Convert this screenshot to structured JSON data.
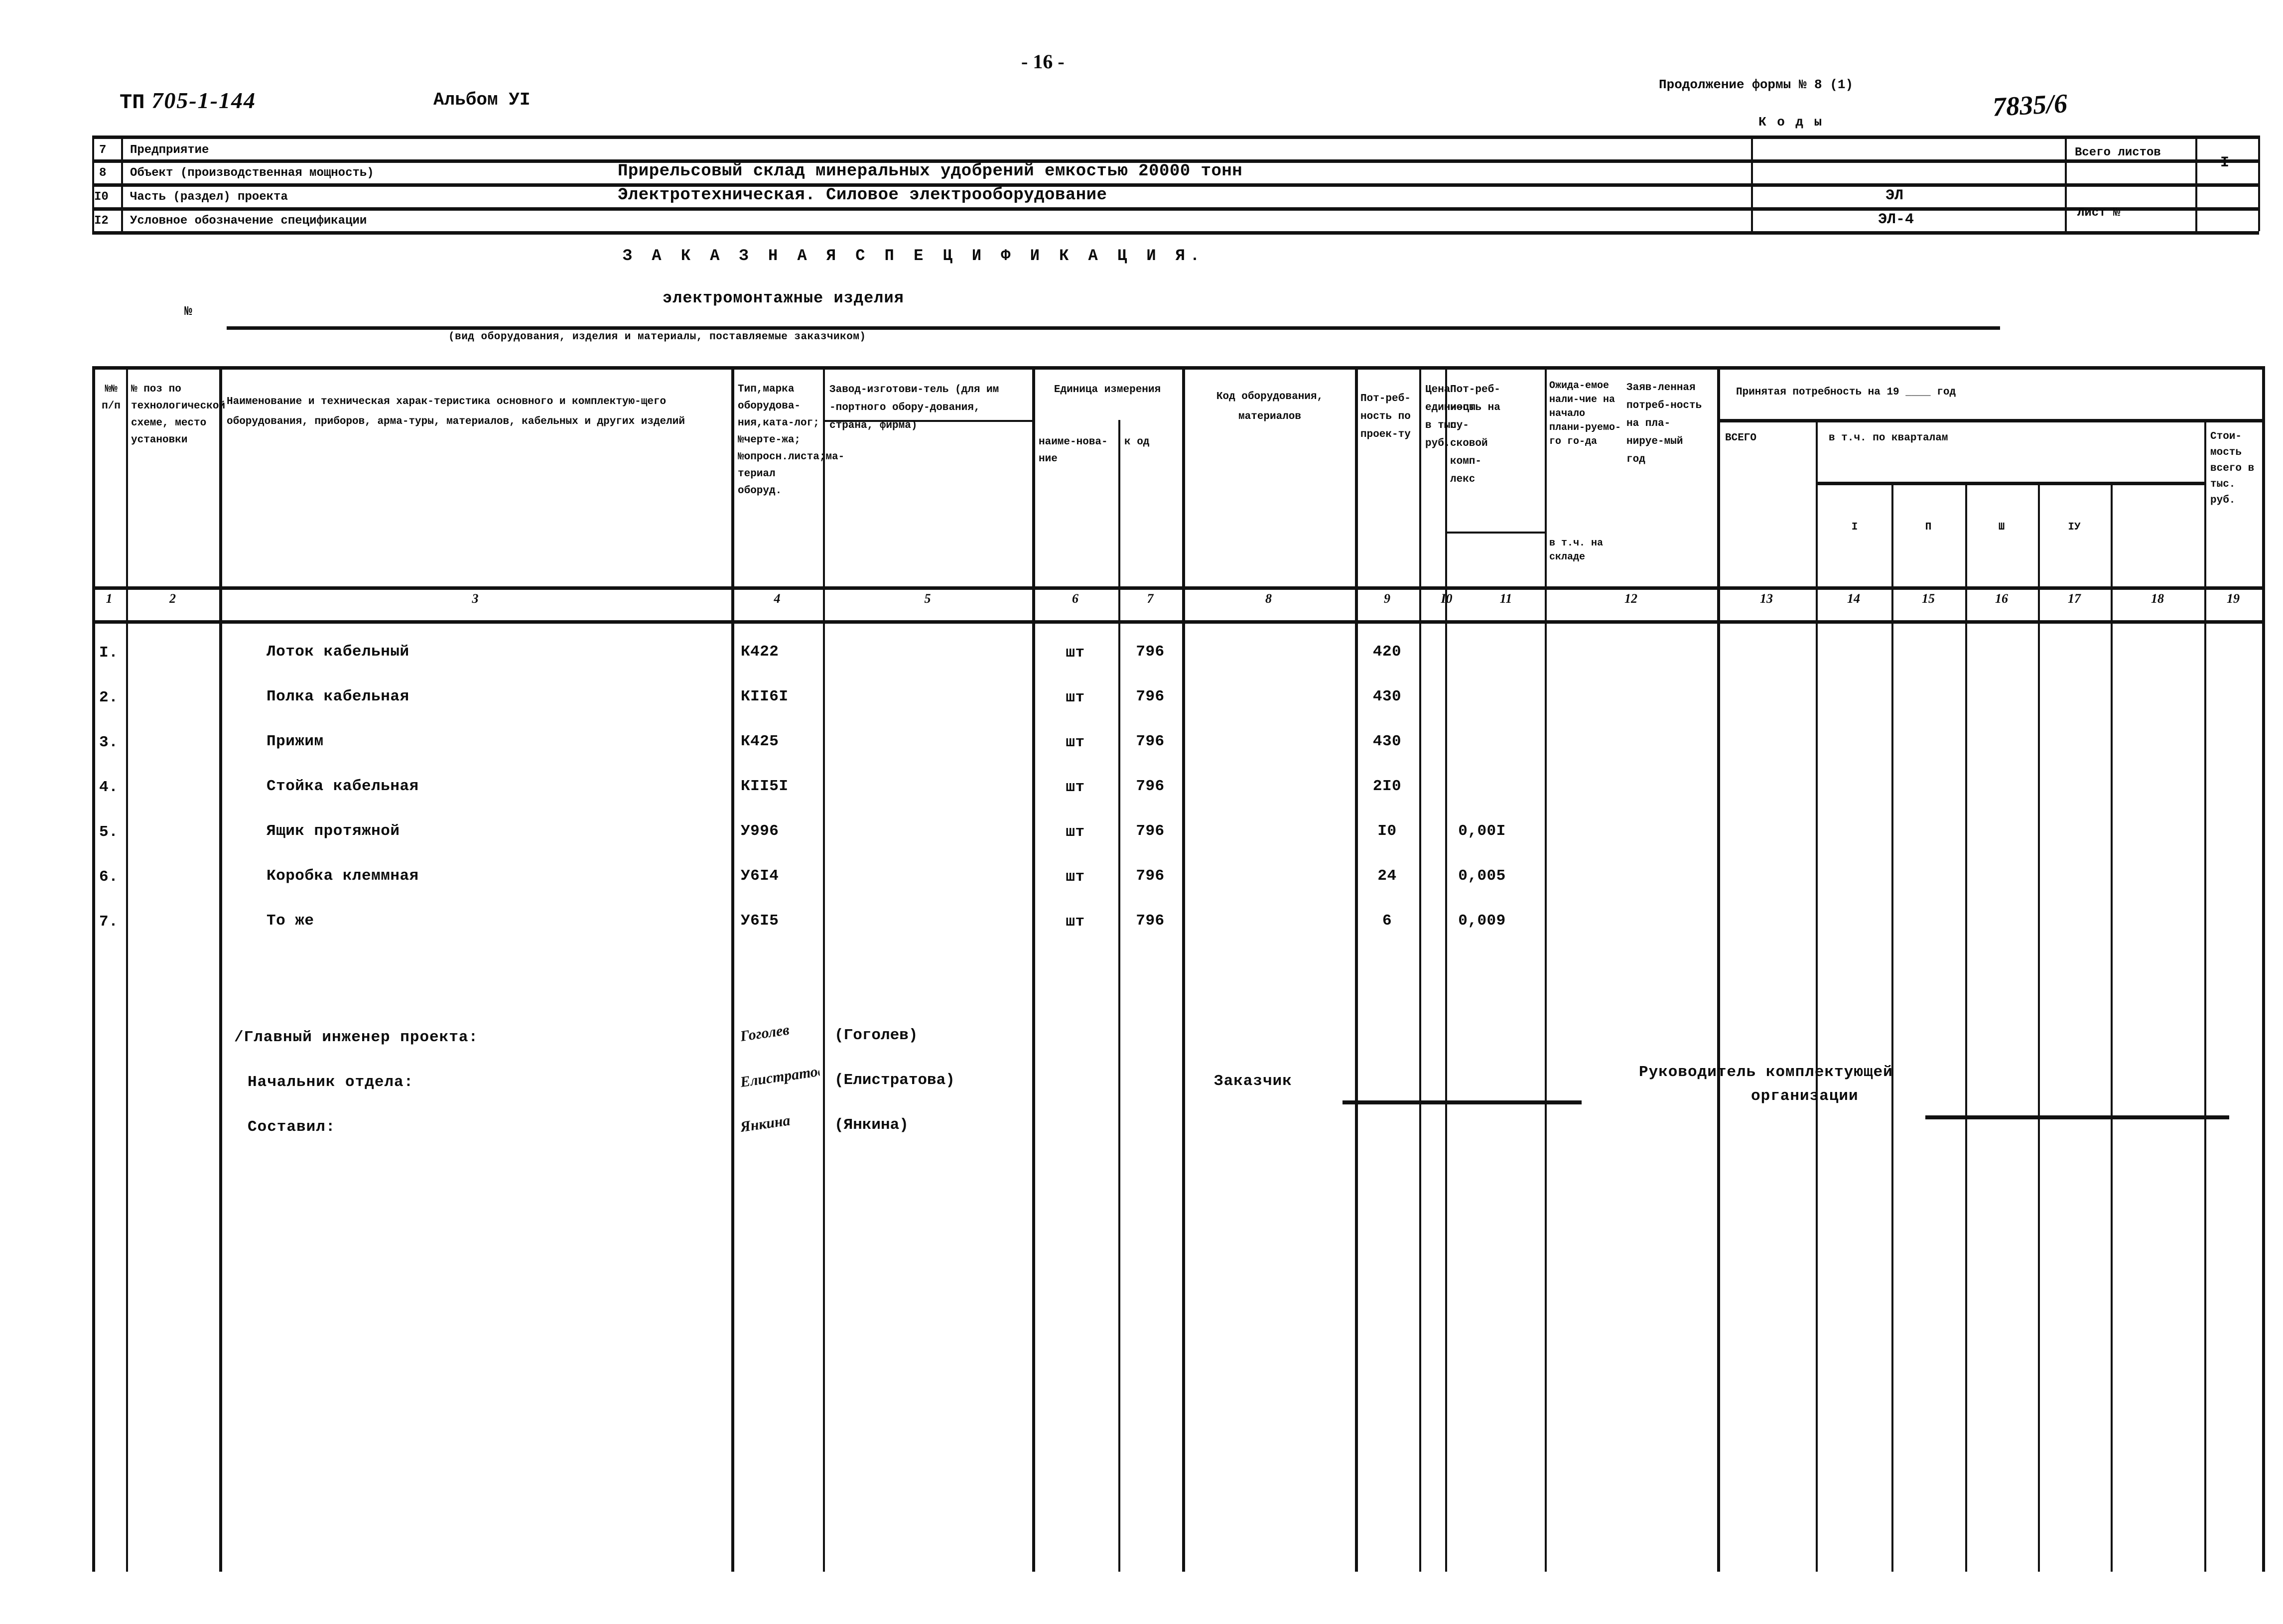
{
  "page": {
    "number": "- 16 -"
  },
  "header": {
    "doc_code_prefix": "ТП",
    "doc_code_number": "705-1-144",
    "album": "Альбом УI",
    "form_continuation": "Продолжение формы  № 8 (1)",
    "kody_label": "К о д ы",
    "kody_value": "7835/6"
  },
  "info_rows": [
    {
      "no": "7",
      "label": "Предприятие",
      "value": "",
      "code": ""
    },
    {
      "no": "8",
      "label": "Объект (производственная мощность)",
      "value": "Прирельсовый склад минеральных удобрений емкостью 20000 тонн",
      "code": ""
    },
    {
      "no": "I0",
      "label": "Часть (раздел) проекта",
      "value": "Электротехническая. Силовое электрооборудование",
      "code": "ЭЛ"
    },
    {
      "no": "I2",
      "label": "Условное обозначение спецификации",
      "value": "",
      "code": "ЭЛ-4"
    }
  ],
  "info_right": {
    "total_sheets_label": "Всего листов",
    "total_sheets_value": "I",
    "sheet_no_label": "Лист №",
    "sheet_no_value": ""
  },
  "title": {
    "main": "З А К А З Н А Я    С П Е Ц И Ф И К А Ц И Я.",
    "kind": "электромонтажные изделия",
    "no_mark": "№",
    "kind_note": "(вид оборудования, изделия и материалы, поставляемые заказчиком)"
  },
  "table": {
    "headers": {
      "c1": "№№ п/п",
      "c2": "№ поз по технологической схеме, место установки",
      "c3": "Наименование и техническая харак-теристика основного и комплектую-щего оборудования, приборов, арма-туры, материалов, кабельных и других изделий",
      "c4": "Тип,марка оборудова-ния,ката-лог;№черте-жа; №опросн.листа;ма-териал оборуд.",
      "c5": "Завод-изготови-тель (для им -портного обору-дования, страна, фирма)",
      "c6_group": "Единица измерения",
      "c6": "наиме-нова-ние",
      "c7": "к од",
      "c8": "Код оборудования, материалов",
      "c9": "Пот-реб-ность по проек-ту",
      "c10": "Цена едини-цы в тыс. руб.",
      "c11": "Пот-реб-ность на пу-сковой комп-лекс",
      "c12": "Ожида-емое нали-чие на начало плани-руемо-го го-да",
      "c12b": "в т.ч. на складе",
      "c13": "Заяв-ленная потреб-ность на пла-нируе-мый год",
      "c14_group": "Принятая потребность на 19 ____ год",
      "c14": "ВСЕГО",
      "c15_group": "в т.ч. по кварталам",
      "c15": "I",
      "c16": "П",
      "c17": "Ш",
      "c18": "IУ",
      "c19": "Стои-мость всего в тыс. руб."
    },
    "column_numbers": [
      "1",
      "2",
      "3",
      "4",
      "5",
      "6",
      "7",
      "8",
      "9",
      "I0",
      "11",
      "12",
      "13",
      "14",
      "15",
      "16",
      "17",
      "18",
      "19"
    ],
    "rows": [
      {
        "no": "I.",
        "pos": "",
        "name": "Лоток кабельный",
        "type": "К422",
        "plant": "",
        "unit_name": "шт",
        "unit_code": "796",
        "eq_code": "",
        "need": "420",
        "price": "",
        "launch": "",
        "expect": "",
        "declared": "",
        "total": "",
        "q1": "",
        "q2": "",
        "q3": "",
        "q4": "",
        "cost": ""
      },
      {
        "no": "2.",
        "pos": "",
        "name": "Полка кабельная",
        "type": "КII6I",
        "plant": "",
        "unit_name": "шт",
        "unit_code": "796",
        "eq_code": "",
        "need": "430",
        "price": "",
        "launch": "",
        "expect": "",
        "declared": "",
        "total": "",
        "q1": "",
        "q2": "",
        "q3": "",
        "q4": "",
        "cost": ""
      },
      {
        "no": "3.",
        "pos": "",
        "name": "Прижим",
        "type": "К425",
        "plant": "",
        "unit_name": "шт",
        "unit_code": "796",
        "eq_code": "",
        "need": "430",
        "price": "",
        "launch": "",
        "expect": "",
        "declared": "",
        "total": "",
        "q1": "",
        "q2": "",
        "q3": "",
        "q4": "",
        "cost": ""
      },
      {
        "no": "4.",
        "pos": "",
        "name": "Стойка кабельная",
        "type": "КII5I",
        "plant": "",
        "unit_name": "шт",
        "unit_code": "796",
        "eq_code": "",
        "need": "2I0",
        "price": "",
        "launch": "",
        "expect": "",
        "declared": "",
        "total": "",
        "q1": "",
        "q2": "",
        "q3": "",
        "q4": "",
        "cost": ""
      },
      {
        "no": "5.",
        "pos": "",
        "name": "Ящик протяжной",
        "type": "У996",
        "plant": "",
        "unit_name": "шт",
        "unit_code": "796",
        "eq_code": "",
        "need": "I0",
        "price": "0,00I",
        "launch": "",
        "expect": "",
        "declared": "",
        "total": "",
        "q1": "",
        "q2": "",
        "q3": "",
        "q4": "",
        "cost": ""
      },
      {
        "no": "6.",
        "pos": "",
        "name": "Коробка клеммная",
        "type": "У6I4",
        "plant": "",
        "unit_name": "шт",
        "unit_code": "796",
        "eq_code": "",
        "need": "24",
        "price": "0,005",
        "launch": "",
        "expect": "",
        "declared": "",
        "total": "",
        "q1": "",
        "q2": "",
        "q3": "",
        "q4": "",
        "cost": ""
      },
      {
        "no": "7.",
        "pos": "",
        "name": "То же",
        "type": "У6I5",
        "plant": "",
        "unit_name": "шт",
        "unit_code": "796",
        "eq_code": "",
        "need": "6",
        "price": "0,009",
        "launch": "",
        "expect": "",
        "declared": "",
        "total": "",
        "q1": "",
        "q2": "",
        "q3": "",
        "q4": "",
        "cost": ""
      }
    ]
  },
  "signatures": {
    "left": [
      {
        "role": "/Главный инженер проекта:",
        "mark": "Гоголев",
        "name": "(Гоголев)"
      },
      {
        "role": "Начальник отдела:",
        "mark": "Елистратова",
        "name": "(Елистратова)"
      },
      {
        "role": "Составил:",
        "mark": "Янкина",
        "name": "(Янкина)"
      }
    ],
    "customer_label": "Заказчик",
    "supplier_label_line1": "Руководитель комплектующей",
    "supplier_label_line2": "организации"
  },
  "colors": {
    "ink": "#0b0b0b",
    "paper": "#ffffff"
  }
}
